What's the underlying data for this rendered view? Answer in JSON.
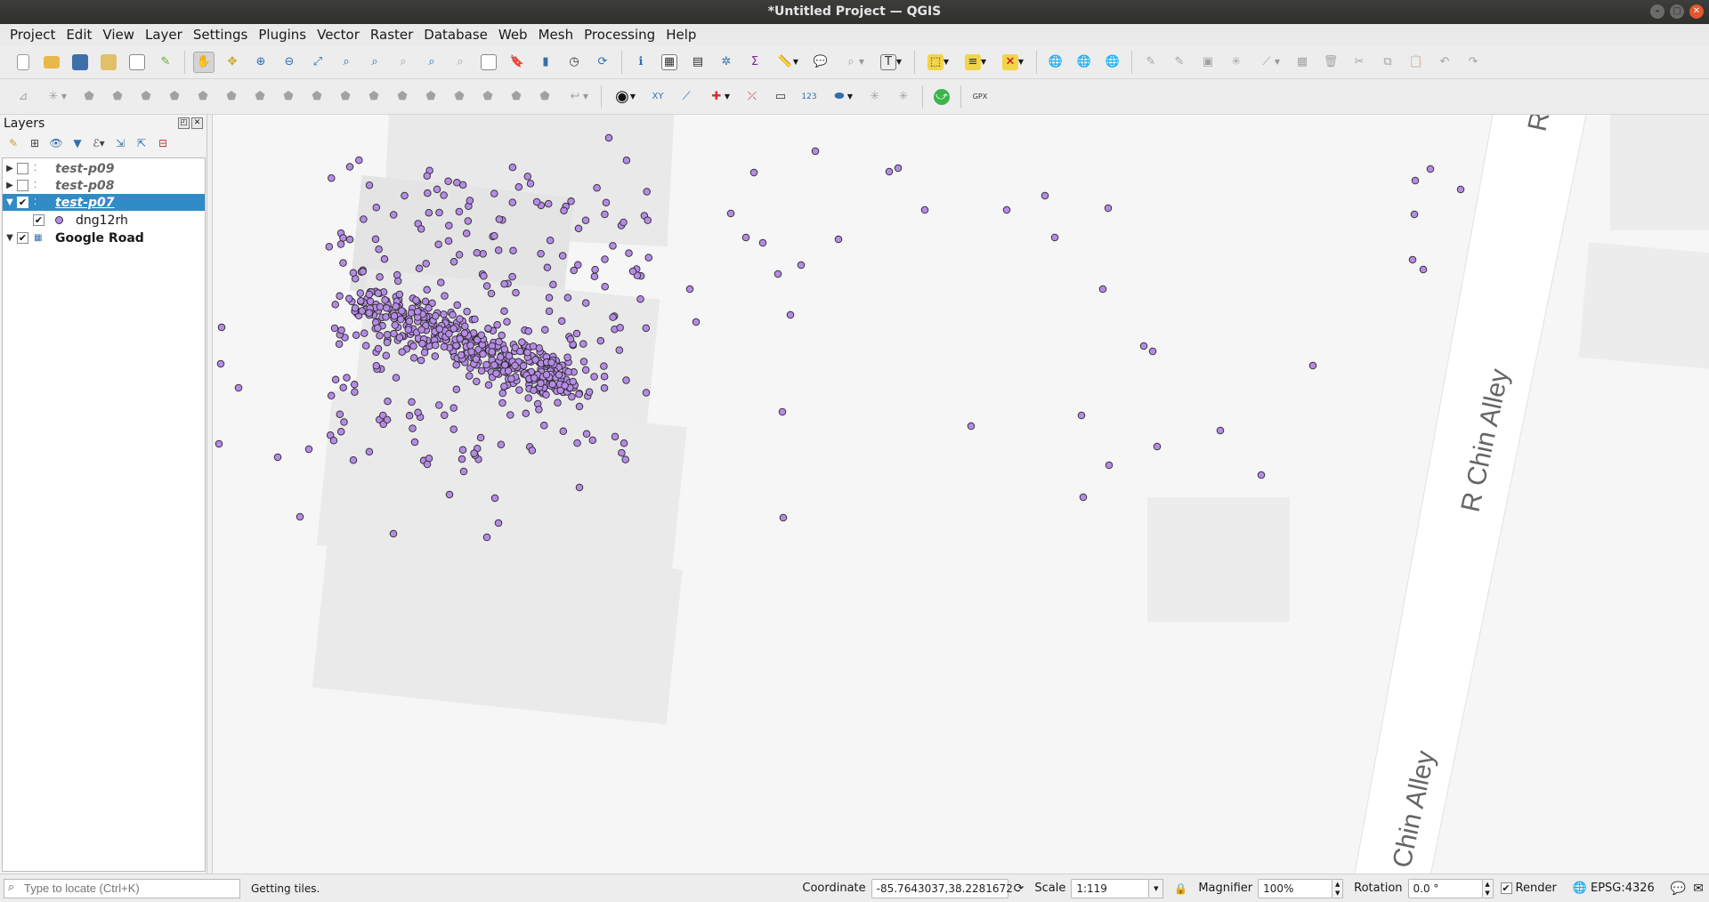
{
  "window": {
    "title": "*Untitled Project — QGIS"
  },
  "menu": [
    "Project",
    "Edit",
    "View",
    "Layer",
    "Settings",
    "Plugins",
    "Vector",
    "Raster",
    "Database",
    "Web",
    "Mesh",
    "Processing",
    "Help"
  ],
  "layers_panel": {
    "title": "Layers",
    "layers": [
      {
        "name": "test-p09",
        "checked": false,
        "expanded": false
      },
      {
        "name": "test-p08",
        "checked": false,
        "expanded": false
      },
      {
        "name": "test-p07",
        "checked": true,
        "expanded": true,
        "selected": true
      },
      {
        "name": "dng12rh",
        "checked": true,
        "child": true
      },
      {
        "name": "Google Road",
        "checked": true,
        "expanded": true
      }
    ]
  },
  "map": {
    "street_labels": [
      "R",
      "R Chin Alley",
      "Chin Alley"
    ],
    "point_color": "#b58be6",
    "point_stroke": "#2a2a2a",
    "background": "#f6f6f6",
    "building_color": "#eaeaea",
    "road_color": "#ffffff"
  },
  "statusbar": {
    "locate_placeholder": "Type to locate (Ctrl+K)",
    "message": "Getting tiles.",
    "coordinate_label": "Coordinate",
    "coordinate_value": "-85.7643037,38.2281672",
    "scale_label": "Scale",
    "scale_value": "1:119",
    "magnifier_label": "Magnifier",
    "magnifier_value": "100%",
    "rotation_label": "Rotation",
    "rotation_value": "0.0 °",
    "render_label": "Render",
    "render_checked": true,
    "crs": "EPSG:4326"
  }
}
